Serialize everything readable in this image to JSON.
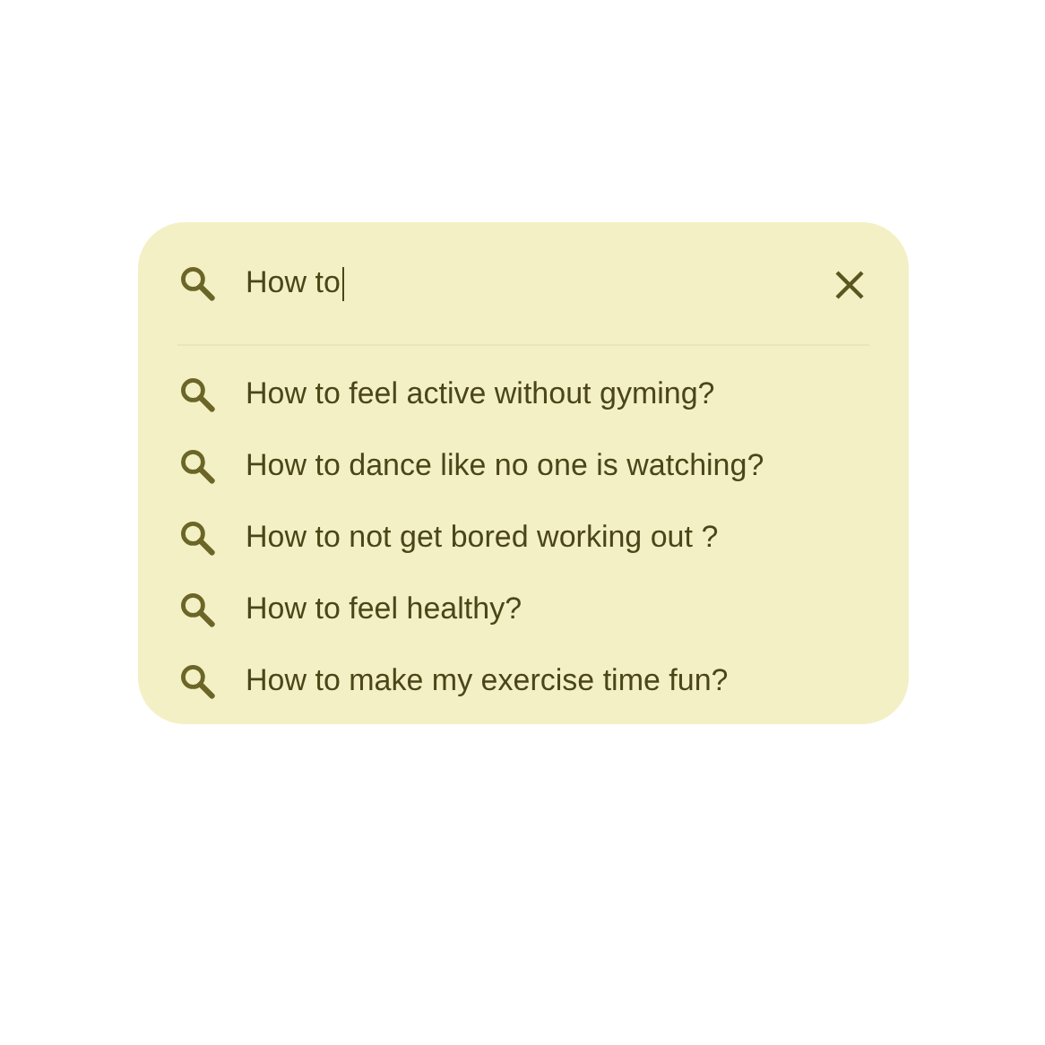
{
  "search": {
    "value": "How to",
    "focused": true
  },
  "suggestions": [
    {
      "text": "How to feel active without gyming?"
    },
    {
      "text": "How to dance like no one is watching?"
    },
    {
      "text": "How to not get bored working out ?"
    },
    {
      "text": "How to feel healthy?"
    },
    {
      "text": "How to make my exercise time fun?"
    }
  ]
}
